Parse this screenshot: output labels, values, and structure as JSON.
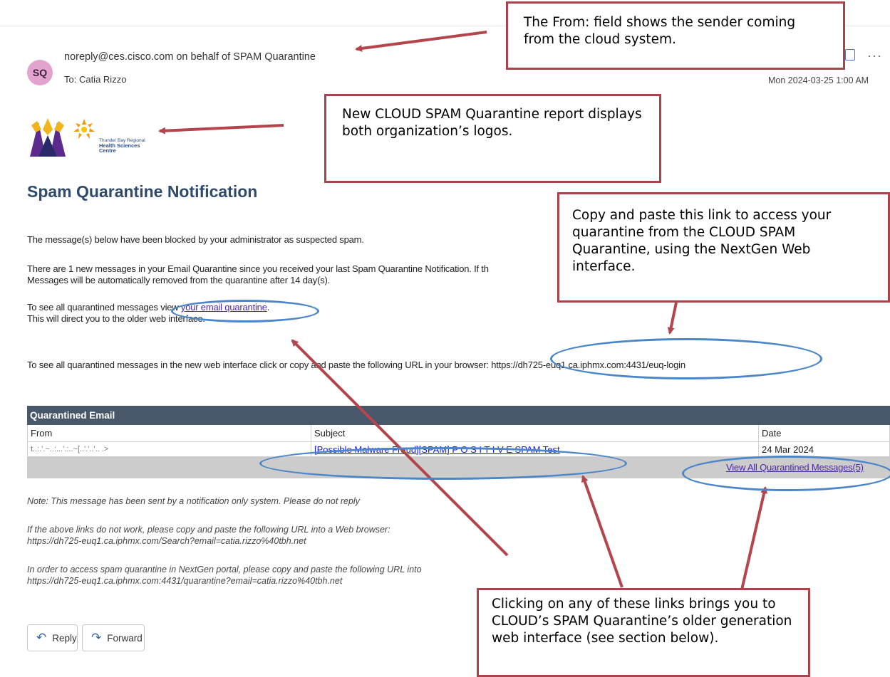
{
  "email": {
    "avatar_initials": "SQ",
    "sender": "noreply@ces.cisco.com on behalf of SPAM Quarantine",
    "to": "To: Catia Rizzo",
    "date": "Mon 2024-03-25 1:00 AM",
    "more_label": "···"
  },
  "logo": {
    "org_line1": "Thunder Bay Regional",
    "org_line2": "Health Sciences",
    "org_line3": "Centre"
  },
  "body": {
    "title": "Spam Quarantine Notification",
    "p1": "The message(s) below have been blocked by your administrator as suspected spam.",
    "p2a": "There are 1 new messages in your Email Quarantine since you received your last Spam Quarantine Notification. If th",
    "p2b": "Messages will be automatically removed from the quarantine after 14 day(s).",
    "p3a": "To see all quarantined messages view ",
    "p3_link": "your email quarantine",
    "p3_period": ".",
    "p3b": "This will direct you to the older web interface.",
    "p4a": "To see all quarantined messages in the new web interface click or copy and paste the following URL in your browser: ",
    "p4_url": "https://dh725-euq1.ca.iphmx.com:4431/euq-login"
  },
  "table": {
    "title": "Quarantined Email",
    "columns": [
      "From",
      "Subject",
      "Date"
    ],
    "rows": [
      {
        "from": "t..:.'.~..:...'.:..~[..'.'..'..  .>",
        "subject": "[Possible Malware Fraud][SPAM] P O S I T I V E SPAM Test",
        "date": "24 Mar 2024"
      }
    ],
    "view_all": "View All Quarantined Messages(5)"
  },
  "notes": {
    "n1": "Note: This message has been sent by a notification only system. Please do not reply",
    "n2a": "If the above links do not work, please copy and paste the following URL into a Web browser:",
    "n2b": "https://dh725-euq1.ca.iphmx.com/Search?email=catia.rizzo%40tbh.net",
    "n3a": "In order to access spam quarantine in NextGen portal, please copy and paste the following URL into",
    "n3b": "https://dh725-euq1.ca.iphmx.com:4431/quarantine?email=catia.rizzo%40tbh.net"
  },
  "actions": {
    "reply": "Reply",
    "forward": "Forward"
  },
  "callouts": {
    "c1": "The From: field shows the sender coming from the cloud system.",
    "c2": "New CLOUD SPAM Quarantine report displays both organization’s logos.",
    "c3": "Copy and paste this link to access your quarantine from the CLOUD SPAM Quarantine, using the NextGen Web interface.",
    "c4": "Clicking on any of these links brings you to CLOUD’s SPAM Quarantine’s older generation web interface (see section below)."
  },
  "colors": {
    "callout_border": "#a8444b",
    "arrow": "#b5454c",
    "ellipse": "#4a86c8",
    "table_header": "#49576a",
    "heading": "#2e4a6c"
  }
}
